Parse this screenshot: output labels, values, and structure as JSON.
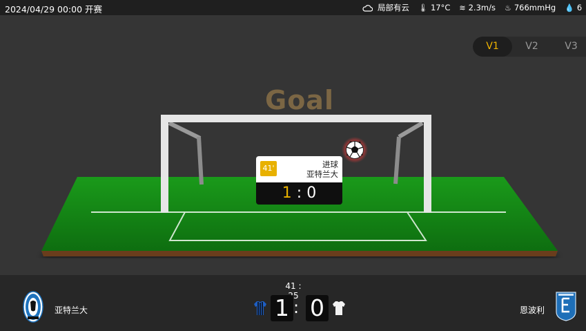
{
  "header": {
    "datetime": "2024/04/29 00:00",
    "status": "开赛",
    "weather": {
      "condition": "局部有云",
      "temperature": "17°C",
      "wind": "2.3m/s",
      "pressure": "766mmHg",
      "humidity_partial": "6"
    }
  },
  "version_tabs": [
    {
      "label": "V1",
      "active": true
    },
    {
      "label": "V2",
      "active": false
    },
    {
      "label": "V3",
      "active": false
    }
  ],
  "animation": {
    "title": "Goal",
    "event": {
      "minute": "41'",
      "type": "进球",
      "team": "亚特兰大",
      "home_score": "1",
      "away_score": "0",
      "separator": ":"
    }
  },
  "match": {
    "clock": "41 : 25",
    "home": {
      "name": "亚特兰大",
      "score": "1"
    },
    "away": {
      "name": "恩波利",
      "score": "0"
    },
    "separator": ":"
  },
  "colors": {
    "accent": "#f0b400",
    "pitch": "#1e8a1e",
    "home_primary": "#1e73be",
    "away_primary": "#1e6fb8"
  }
}
